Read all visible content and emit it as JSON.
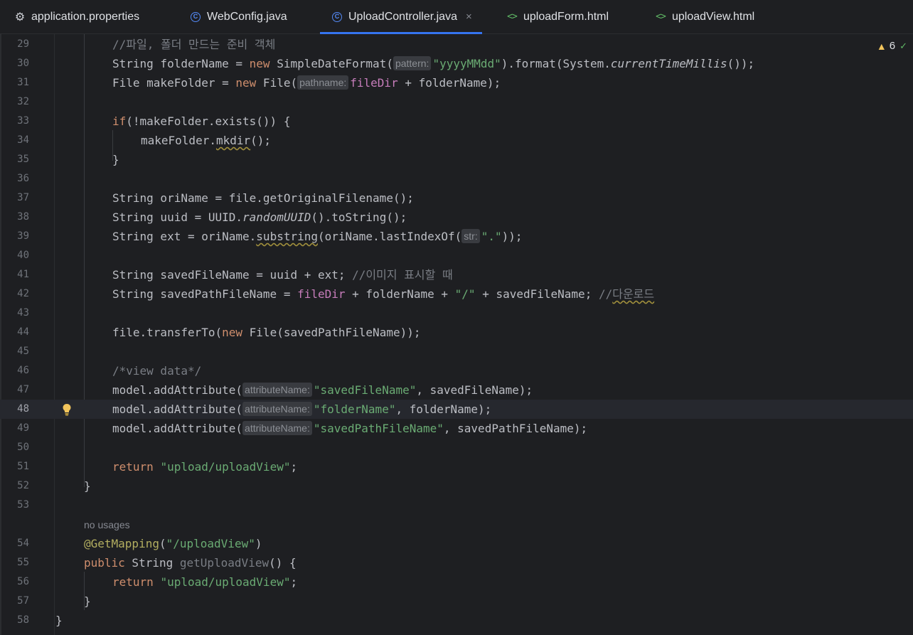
{
  "tabs": [
    {
      "label": "application.properties",
      "icon": "gear-icon",
      "active": false
    },
    {
      "label": "WebConfig.java",
      "icon": "java-class-icon",
      "active": false
    },
    {
      "label": "UploadController.java",
      "icon": "java-class-icon",
      "active": true
    },
    {
      "label": "uploadForm.html",
      "icon": "html-file-icon",
      "active": false
    },
    {
      "label": "uploadView.html",
      "icon": "html-file-icon",
      "active": false
    }
  ],
  "tab_close_glyph": "×",
  "warnings": {
    "count": "6"
  },
  "editor": {
    "current_line": "48",
    "lines": {
      "l29": {
        "num": "29",
        "comment": "//파일, 폴더 만드는 준비 객체"
      },
      "l30": {
        "num": "30",
        "t1": "String folderName = ",
        "kw": "new",
        "t2": " SimpleDateFormat(",
        "hint": "pattern:",
        "str": "\"yyyyMMdd\"",
        "t3": ").format(System.",
        "itl": "currentTimeMillis",
        "t4": "());"
      },
      "l31": {
        "num": "31",
        "t1": "File makeFolder = ",
        "kw": "new",
        "t2": " File(",
        "hint": "pathname:",
        "fld": "fileDir",
        "t3": " + folderName);"
      },
      "l32": {
        "num": "32"
      },
      "l33": {
        "num": "33",
        "kw": "if",
        "t1": "(!makeFolder.exists()) {"
      },
      "l34": {
        "num": "34",
        "t1": "makeFolder.",
        "warn": "mkdir",
        "t2": "();"
      },
      "l35": {
        "num": "35",
        "t1": "}"
      },
      "l36": {
        "num": "36"
      },
      "l37": {
        "num": "37",
        "t1": "String oriName = file.getOriginalFilename();"
      },
      "l38": {
        "num": "38",
        "t1": "String uuid = UUID.",
        "itl": "randomUUID",
        "t2": "().toString();"
      },
      "l39": {
        "num": "39",
        "t1": "String ext = oriName.",
        "warn": "substring",
        "t2": "(oriName.lastIndexOf(",
        "hint": "str:",
        "str": "\".\"",
        "t3": "));"
      },
      "l40": {
        "num": "40"
      },
      "l41": {
        "num": "41",
        "t1": "String savedFileName = uuid + ext; ",
        "comment": "//이미지 표시할 때"
      },
      "l42": {
        "num": "42",
        "t1": "String savedPathFileName = ",
        "fld": "fileDir",
        "t2": " + folderName + ",
        "str": "\"/\"",
        "t3": " + savedFileName; ",
        "comment": "//",
        "comment_warn": "다운로드"
      },
      "l43": {
        "num": "43"
      },
      "l44": {
        "num": "44",
        "t1": "file.transferTo(",
        "kw": "new",
        "t2": " File(savedPathFileName));"
      },
      "l45": {
        "num": "45"
      },
      "l46": {
        "num": "46",
        "comment": "/*view data*/"
      },
      "l47": {
        "num": "47",
        "t1": "model.addAttribute(",
        "hint": "attributeName:",
        "str": "\"savedFileName\"",
        "t2": ", savedFileName);"
      },
      "l48": {
        "num": "48",
        "t1": "model.addAttribute(",
        "hint": "attributeName:",
        "str": "\"folderName\"",
        "t2": ", folderName);"
      },
      "l49": {
        "num": "49",
        "t1": "model.addAttribute(",
        "hint": "attributeName:",
        "str": "\"savedPathFileName\"",
        "t2": ", savedPathFileName);"
      },
      "l50": {
        "num": "50"
      },
      "l51": {
        "num": "51",
        "kw": "return",
        "t1": " ",
        "str": "\"upload/uploadView\"",
        "t2": ";"
      },
      "l52": {
        "num": "52",
        "t1": "}"
      },
      "l53": {
        "num": "53"
      },
      "usages": "no usages",
      "l54": {
        "num": "54",
        "ann": "@GetMapping",
        "t1": "(",
        "str": "\"/uploadView\"",
        "t2": ")"
      },
      "l55": {
        "num": "55",
        "kw": "public",
        "t1": " String ",
        "unused": "getUploadView",
        "t2": "() {"
      },
      "l56": {
        "num": "56",
        "kw": "return",
        "t1": " ",
        "str": "\"upload/uploadView\"",
        "t2": ";"
      },
      "l57": {
        "num": "57",
        "t1": "}"
      },
      "l58": {
        "num": "58",
        "t1": "}"
      }
    }
  }
}
